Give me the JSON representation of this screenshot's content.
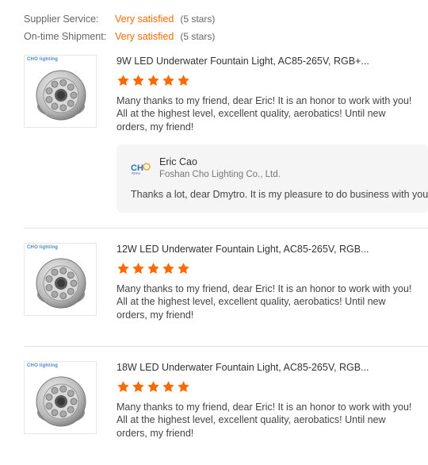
{
  "shop_ratings": [
    {
      "label": "Supplier Service:",
      "value": "Very satisfied",
      "stars": "(5 stars)"
    },
    {
      "label": "On-time Shipment:",
      "value": "Very satisfied",
      "stars": "(5 stars)"
    }
  ],
  "reviews": [
    {
      "thumb_brand": "CHO lighting",
      "title": "9W LED Underwater Fountain Light, AC85-265V, RGB+...",
      "rating": 5,
      "text": "Many thanks to my friend, dear Eric! It is an honor to work with you! All at the highest level, excellent quality, aerobatics! Until new orders, my friend!",
      "reply": {
        "name": "Eric Cao",
        "company": "Foshan Cho Lighting Co., Ltd.",
        "text": "Thanks a lot, dear Dmytro. It is my pleasure to do business with you."
      }
    },
    {
      "thumb_brand": "CHO lighting",
      "title": "12W LED Underwater Fountain Light, AC85-265V, RGB...",
      "rating": 5,
      "text": "Many thanks to my friend, dear Eric! It is an honor to work with you! All at the highest level, excellent quality, aerobatics! Until new orders, my friend!"
    },
    {
      "thumb_brand": "CHO lighting",
      "title": "18W LED Underwater Fountain Light, AC85-265V, RGB...",
      "rating": 5,
      "text": "Many thanks to my friend, dear Eric! It is an honor to work with you! All at the highest level, excellent quality, aerobatics! Until new orders, my friend!"
    }
  ],
  "colors": {
    "accent": "#ff6a00",
    "reply_bg": "#f5f5f5",
    "brand_blue": "#4a86c8"
  }
}
